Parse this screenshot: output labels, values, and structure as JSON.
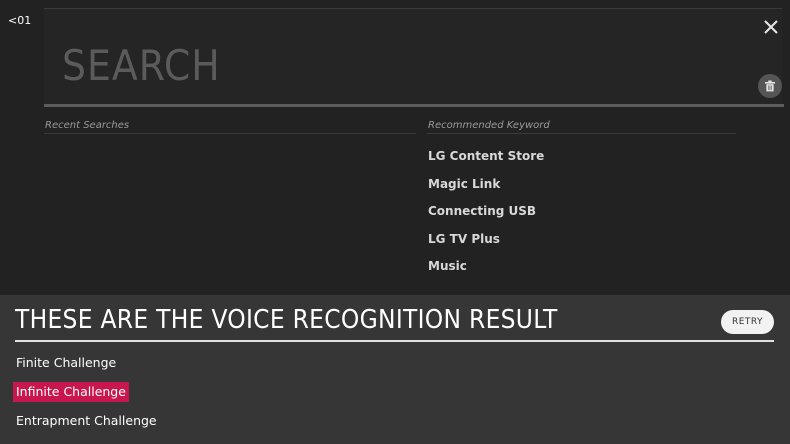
{
  "nav": {
    "back_label": "<01"
  },
  "search": {
    "placeholder": "SEARCH",
    "value": ""
  },
  "icons": {
    "close": "close-icon",
    "clear_history": "trash-icon"
  },
  "recent_searches": {
    "heading": "Recent Searches",
    "items": []
  },
  "recommended": {
    "heading": "Recommended Keyword",
    "items": [
      {
        "label": "LG Content Store"
      },
      {
        "label": "Magic Link"
      },
      {
        "label": "Connecting USB"
      },
      {
        "label": "LG TV Plus"
      },
      {
        "label": "Music"
      }
    ]
  },
  "voice": {
    "title": "THESE ARE THE VOICE RECOGNITION RESULT",
    "retry_label": "RETRY",
    "results": [
      {
        "label": "Finite Challenge",
        "selected": false
      },
      {
        "label": "Infinite Challenge",
        "selected": true
      },
      {
        "label": "Entrapment Challenge",
        "selected": false
      }
    ]
  },
  "colors": {
    "background": "#222222",
    "voice_panel": "#363636",
    "highlight": "#c8174f",
    "text": "#ffffff"
  }
}
